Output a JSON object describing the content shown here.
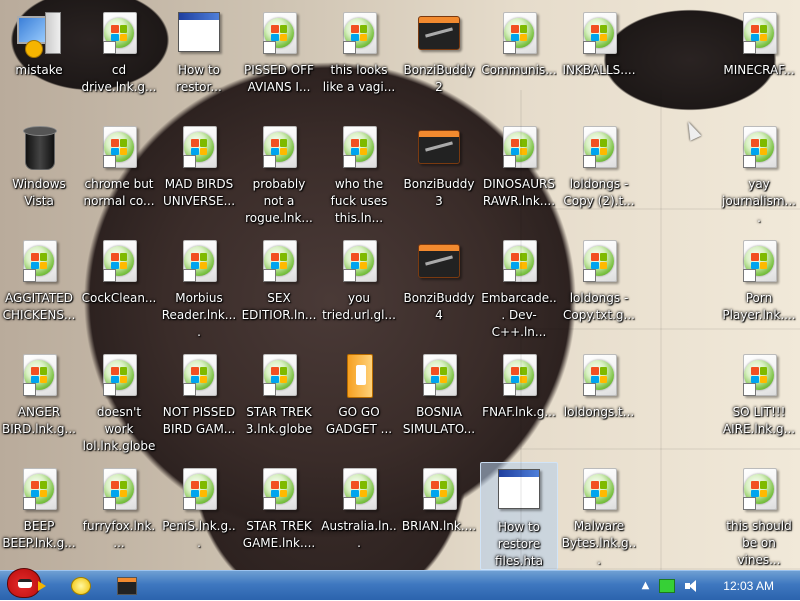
{
  "desktop": {
    "icons": [
      {
        "id": "i00",
        "label": "mistake",
        "type": "computer",
        "col": 0,
        "row": 0
      },
      {
        "id": "i01",
        "label": "cd drive.lnk.g...",
        "type": "shortcut",
        "col": 1,
        "row": 0
      },
      {
        "id": "i02",
        "label": "How to restor...",
        "type": "window",
        "col": 2,
        "row": 0
      },
      {
        "id": "i03",
        "label": "PISSED OFF AVIANS I...",
        "type": "shortcut",
        "col": 3,
        "row": 0
      },
      {
        "id": "i04",
        "label": "this looks like a vagi...",
        "type": "shortcut",
        "col": 4,
        "row": 0
      },
      {
        "id": "i05",
        "label": "BonziBuddy2",
        "type": "bonzi",
        "col": 5,
        "row": 0
      },
      {
        "id": "i06",
        "label": "Communis...",
        "type": "shortcut",
        "col": 6,
        "row": 0
      },
      {
        "id": "i07",
        "label": "INKBALLS....",
        "type": "shortcut",
        "col": 7,
        "row": 0
      },
      {
        "id": "i08",
        "label": "MINECRAF...",
        "type": "shortcut",
        "col": 9,
        "row": 0
      },
      {
        "id": "i10",
        "label": "Windows Vista",
        "type": "bin",
        "col": 0,
        "row": 1
      },
      {
        "id": "i11",
        "label": "chrome but normal co...",
        "type": "shortcut",
        "col": 1,
        "row": 1
      },
      {
        "id": "i12",
        "label": "MAD BIRDS UNIVERSE...",
        "type": "shortcut",
        "col": 2,
        "row": 1
      },
      {
        "id": "i13",
        "label": "probably not a rogue.lnk...",
        "type": "shortcut",
        "col": 3,
        "row": 1
      },
      {
        "id": "i14",
        "label": "who the fuck uses this.ln...",
        "type": "shortcut",
        "col": 4,
        "row": 1
      },
      {
        "id": "i15",
        "label": "BonziBuddy3",
        "type": "bonzi",
        "col": 5,
        "row": 1
      },
      {
        "id": "i16",
        "label": "DINOSAURS RAWR.lnk....",
        "type": "shortcut",
        "col": 6,
        "row": 1
      },
      {
        "id": "i17",
        "label": "loldongs - Copy (2).t...",
        "type": "shortcut",
        "col": 7,
        "row": 1
      },
      {
        "id": "i18",
        "label": "yay journalism....",
        "type": "shortcut",
        "col": 9,
        "row": 1
      },
      {
        "id": "i20",
        "label": "AGGITATED CHICKENS...",
        "type": "shortcut",
        "col": 0,
        "row": 2
      },
      {
        "id": "i21",
        "label": "CockClean...",
        "type": "shortcut",
        "col": 1,
        "row": 2
      },
      {
        "id": "i22",
        "label": "Morbius Reader.lnk....",
        "type": "shortcut",
        "col": 2,
        "row": 2
      },
      {
        "id": "i23",
        "label": "SEX EDITIOR.ln...",
        "type": "shortcut",
        "col": 3,
        "row": 2
      },
      {
        "id": "i24",
        "label": "you tried.url.gl...",
        "type": "shortcut",
        "col": 4,
        "row": 2
      },
      {
        "id": "i25",
        "label": "BonziBuddy4",
        "type": "bonzi",
        "col": 5,
        "row": 2
      },
      {
        "id": "i26",
        "label": "Embarcade... Dev-C++.ln...",
        "type": "shortcut",
        "col": 6,
        "row": 2
      },
      {
        "id": "i27",
        "label": "loldongs - Copy.txt.g...",
        "type": "shortcut",
        "col": 7,
        "row": 2
      },
      {
        "id": "i28",
        "label": "Porn Player.lnk....",
        "type": "shortcut",
        "col": 9,
        "row": 2
      },
      {
        "id": "i30",
        "label": "ANGER BIRD.lnk.g...",
        "type": "shortcut",
        "col": 0,
        "row": 3
      },
      {
        "id": "i31",
        "label": "doesn't work lol.lnk.globe",
        "type": "shortcut",
        "col": 1,
        "row": 3
      },
      {
        "id": "i32",
        "label": "NOT PISSED BIRD GAM...",
        "type": "shortcut",
        "col": 2,
        "row": 3
      },
      {
        "id": "i33",
        "label": "STAR TREK 3.lnk.globe",
        "type": "shortcut",
        "col": 3,
        "row": 3
      },
      {
        "id": "i34",
        "label": "GO GO GADGET ...",
        "type": "folder",
        "col": 4,
        "row": 3
      },
      {
        "id": "i35",
        "label": "BOSNIA SIMULATO...",
        "type": "shortcut",
        "col": 5,
        "row": 3
      },
      {
        "id": "i36",
        "label": "FNAF.lnk.g...",
        "type": "shortcut",
        "col": 6,
        "row": 3
      },
      {
        "id": "i37",
        "label": "loldongs.t...",
        "type": "shortcut",
        "col": 7,
        "row": 3
      },
      {
        "id": "i38",
        "label": "SO LIT!!! AIRE.lnk.g...",
        "type": "shortcut",
        "col": 9,
        "row": 3
      },
      {
        "id": "i40",
        "label": "BEEP BEEP.lnk.g...",
        "type": "shortcut",
        "col": 0,
        "row": 4
      },
      {
        "id": "i41",
        "label": "furryfox.lnk....",
        "type": "shortcut",
        "col": 1,
        "row": 4
      },
      {
        "id": "i42",
        "label": "PeniS.lnk.g...",
        "type": "shortcut",
        "col": 2,
        "row": 4
      },
      {
        "id": "i43",
        "label": "STAR TREK GAME.lnk....",
        "type": "shortcut",
        "col": 3,
        "row": 4
      },
      {
        "id": "i44",
        "label": "Australia.ln...",
        "type": "shortcut",
        "col": 4,
        "row": 4
      },
      {
        "id": "i45",
        "label": "BRIAN.lnk....",
        "type": "shortcut",
        "col": 5,
        "row": 4
      },
      {
        "id": "i46",
        "label": "How to restore files.hta",
        "type": "window",
        "col": 6,
        "row": 4,
        "selected": true
      },
      {
        "id": "i47",
        "label": "Malware Bytes.lnk.g...",
        "type": "shortcut",
        "col": 7,
        "row": 4
      },
      {
        "id": "i48",
        "label": "this should be on vines...",
        "type": "shortcut",
        "col": 9,
        "row": 4
      }
    ]
  },
  "taskbar": {
    "start_icon": "angry-bird-icon",
    "pinned": [
      {
        "name": "explorer-icon"
      },
      {
        "name": "media-icon"
      }
    ],
    "tray": {
      "clock": "12:03 AM"
    }
  }
}
